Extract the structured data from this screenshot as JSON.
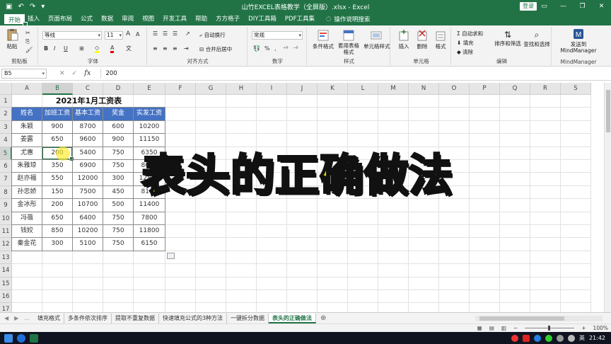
{
  "window": {
    "title": "山竹EXCEL表格教学（全屏版）.xlsx - Excel",
    "login_button": "登录"
  },
  "menu": {
    "tabs": [
      "文件",
      "开始",
      "插入",
      "页面布局",
      "公式",
      "数据",
      "审阅",
      "视图",
      "开发工具",
      "帮助",
      "方方格子",
      "DIY工具箱",
      "PDF工具集"
    ],
    "active_tab": "开始",
    "tell_me": "操作说明搜索"
  },
  "ribbon": {
    "clipboard": {
      "paste": "粘贴",
      "group": "剪贴板"
    },
    "font": {
      "name": "等线",
      "size": "11",
      "bold": "B",
      "italic": "I",
      "underline": "U",
      "grow": "A",
      "shrink": "A",
      "group": "字体"
    },
    "alignment": {
      "wrap": "自动换行",
      "merge": "合并后居中",
      "group": "对齐方式"
    },
    "number": {
      "format": "常规",
      "group": "数字"
    },
    "styles": {
      "conditional": "条件格式",
      "table_format": "套用表格格式",
      "cell_styles": "单元格样式",
      "group": "样式"
    },
    "cells": {
      "insert": "插入",
      "delete": "删除",
      "format": "格式",
      "group": "单元格"
    },
    "editing": {
      "autosum": "自动求和",
      "fill": "填充",
      "clear": "清除",
      "sort": "排序和筛选",
      "find": "查找和选择",
      "group": "编辑"
    },
    "mindmanager": {
      "send": "发送到MindManager",
      "group": "MindManager"
    }
  },
  "formula_bar": {
    "name_box": "B5",
    "fx": "fx",
    "value": "200"
  },
  "sheet": {
    "columns": [
      "A",
      "B",
      "C",
      "D",
      "E",
      "F",
      "G",
      "H",
      "I",
      "J",
      "K",
      "L",
      "M",
      "N",
      "O",
      "P",
      "Q",
      "R",
      "S"
    ],
    "rows": [
      "1",
      "2",
      "3",
      "4",
      "5",
      "6",
      "7",
      "8",
      "9",
      "10",
      "11",
      "12",
      "13",
      "14",
      "15",
      "16",
      "17"
    ],
    "selected_col": "B",
    "selected_row": "5",
    "title": "2021年1月工资表",
    "headers": [
      "姓名",
      "加班工资",
      "基本工资",
      "奖金",
      "实发工资"
    ],
    "data": [
      [
        "朱颖",
        "900",
        "8700",
        "600",
        "10200"
      ],
      [
        "姜露",
        "650",
        "9600",
        "900",
        "11150"
      ],
      [
        "尤惠",
        "200",
        "5400",
        "750",
        "6350"
      ],
      [
        "朱雅琼",
        "350",
        "6900",
        "750",
        "8000"
      ],
      [
        "赵亦福",
        "550",
        "12000",
        "300",
        "12850"
      ],
      [
        "孙忠娇",
        "150",
        "7500",
        "450",
        "8100"
      ],
      [
        "金冰彤",
        "200",
        "10700",
        "500",
        "11400"
      ],
      [
        "冯蓓",
        "650",
        "6400",
        "750",
        "7800"
      ],
      [
        "钱姣",
        "850",
        "10200",
        "750",
        "11800"
      ],
      [
        "秦金花",
        "300",
        "5100",
        "750",
        "6150"
      ]
    ]
  },
  "overlay_text": "表头的正确做法",
  "sheet_tabs": {
    "nav": [
      "◀",
      "▶",
      "..."
    ],
    "tabs": [
      "填充格式",
      "多条件依次排序",
      "提取不重复数据",
      "快速填充公式的3种方法",
      "一键拆分数据",
      "表头的正确做法"
    ],
    "active": "表头的正确做法",
    "add": "⊕"
  },
  "status": {
    "zoom": "100%"
  },
  "taskbar": {
    "time": "21:42",
    "lang": "英"
  }
}
